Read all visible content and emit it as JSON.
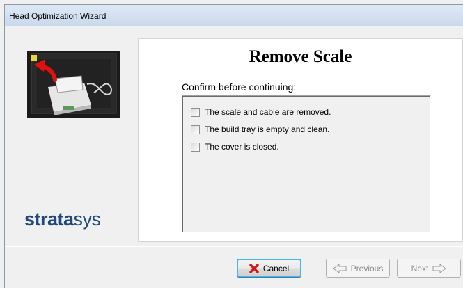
{
  "window": {
    "title": "Head Optimization Wizard"
  },
  "left_pane": {
    "logo_bold": "strata",
    "logo_light": "sys",
    "photo_icon": "scale-removal-photo"
  },
  "main": {
    "title": "Remove Scale",
    "subtitle": "Confirm before continuing:",
    "checklist": [
      {
        "label": "The scale and cable are removed.",
        "checked": false
      },
      {
        "label": "The build tray is empty and clean.",
        "checked": false
      },
      {
        "label": "The cover is closed.",
        "checked": false
      }
    ]
  },
  "buttons": {
    "cancel": {
      "label": "Cancel",
      "icon": "red-x-icon",
      "enabled": true
    },
    "previous": {
      "label": "Previous",
      "icon": "previous-arrow-icon",
      "enabled": false
    },
    "next": {
      "label": "Next",
      "icon": "next-arrow-icon",
      "enabled": false
    }
  },
  "colors": {
    "logo": "#23487d",
    "cancel_icon": "#d01818",
    "disabled_text": "#8d8d8d"
  }
}
